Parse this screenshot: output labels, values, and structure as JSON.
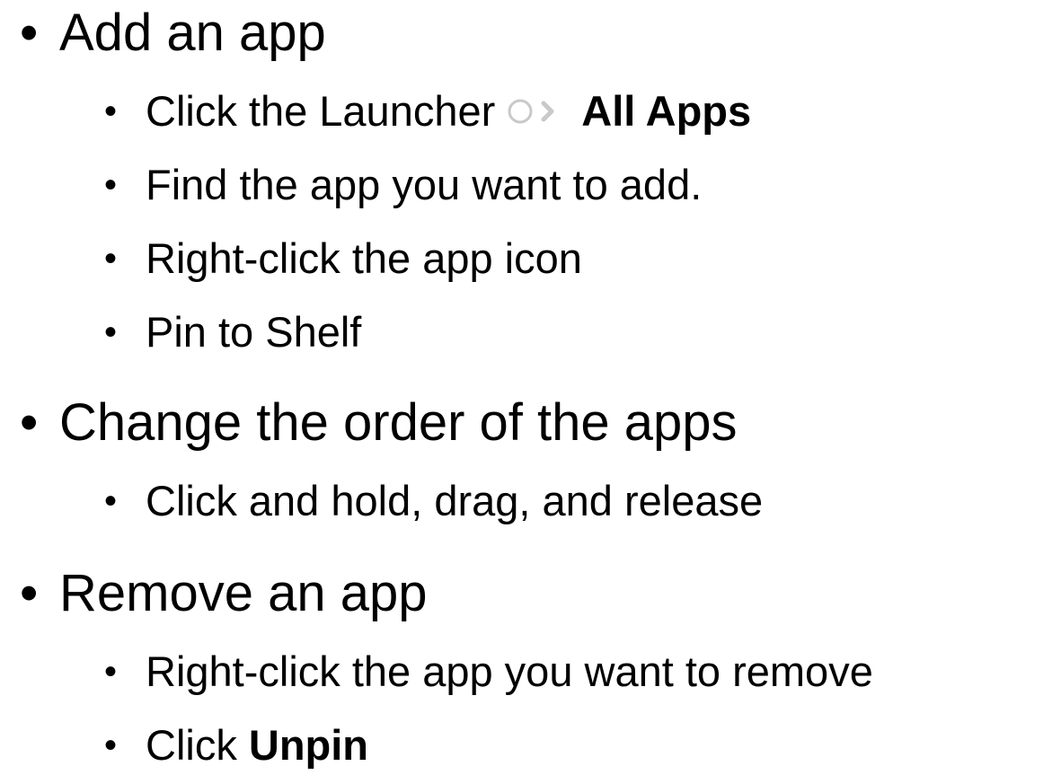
{
  "bullet_char": "•",
  "sections": [
    {
      "heading": "Add an app",
      "items": [
        {
          "before": "Click the Launcher",
          "icon": "launcher-icon",
          "after_bold": "All Apps"
        },
        {
          "text": "Find the app you want to add."
        },
        {
          "text": "Right-click the app icon"
        },
        {
          "text": "Pin to Shelf"
        }
      ]
    },
    {
      "heading": "Change the order of the apps",
      "items": [
        {
          "text": "Click and hold, drag, and release"
        }
      ]
    },
    {
      "heading": "Remove an app",
      "items": [
        {
          "text": "Right-click the app you want to remove"
        },
        {
          "before": "Click",
          "after_bold": "Unpin"
        }
      ]
    }
  ]
}
